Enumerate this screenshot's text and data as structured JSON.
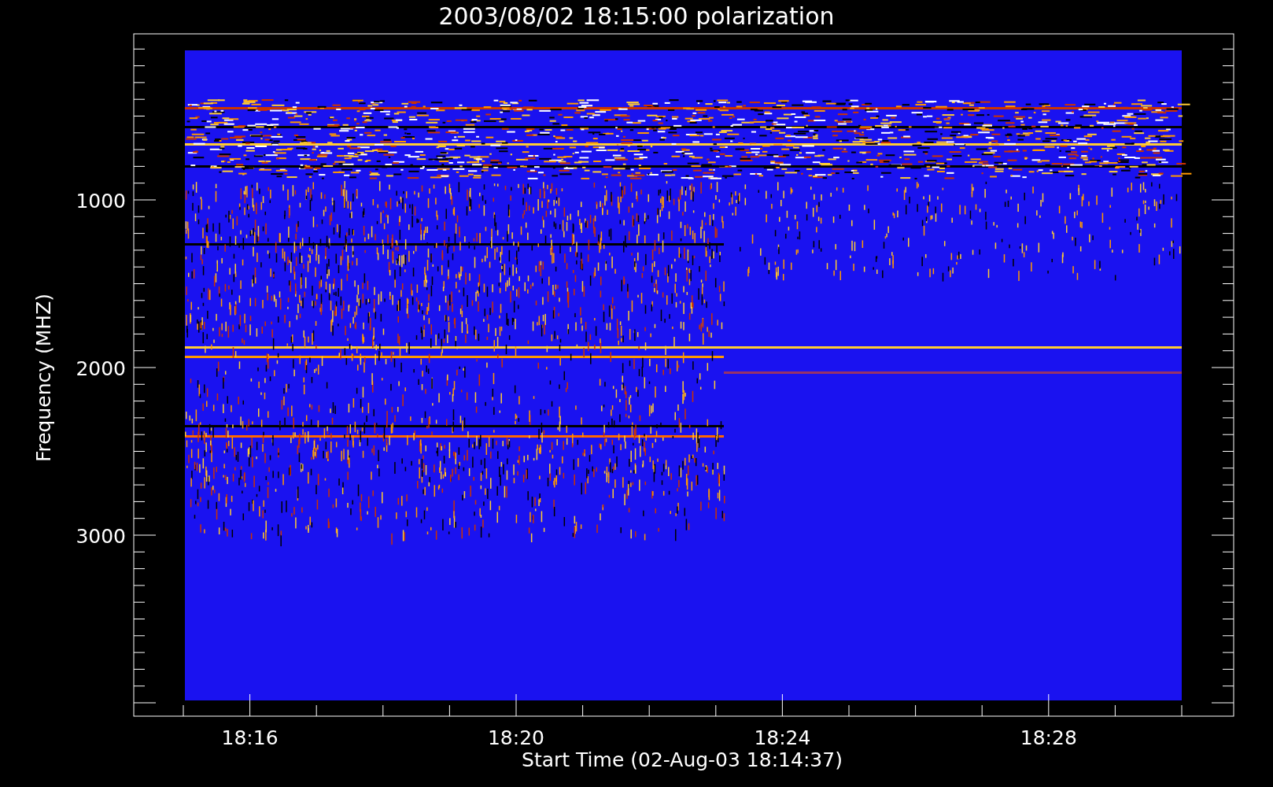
{
  "title": "2003/08/02 18:15:00 polarization",
  "y_axis": {
    "label": "Frequency (MHZ)",
    "tick_labels": [
      "1000",
      "2000",
      "3000"
    ]
  },
  "x_axis": {
    "label": "Start Time (02-Aug-03 18:14:37)",
    "tick_labels": [
      "18:16",
      "18:20",
      "18:24",
      "18:28"
    ]
  }
}
